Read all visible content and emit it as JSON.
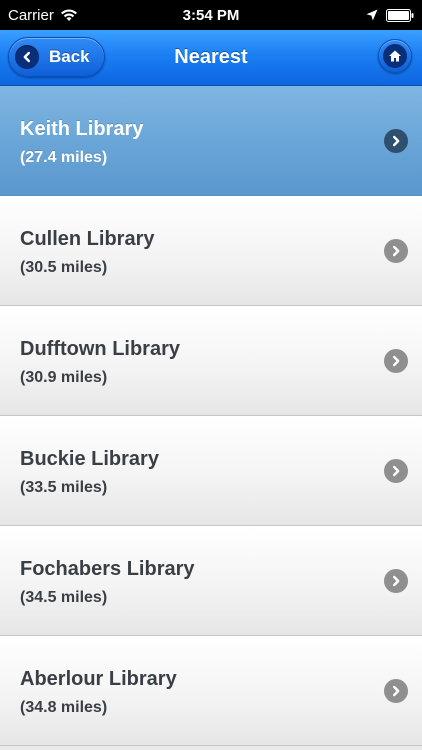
{
  "status_bar": {
    "carrier": "Carrier",
    "time": "3:54 PM",
    "icons": [
      "wifi-icon",
      "location-icon",
      "battery-icon"
    ]
  },
  "nav": {
    "back_label": "Back",
    "title": "Nearest",
    "home_icon": "home-icon"
  },
  "libraries": [
    {
      "name": "Keith Library",
      "distance": "(27.4 miles)",
      "selected": true
    },
    {
      "name": "Cullen Library",
      "distance": "(30.5 miles)",
      "selected": false
    },
    {
      "name": "Dufftown Library",
      "distance": "(30.9 miles)",
      "selected": false
    },
    {
      "name": "Buckie Library",
      "distance": "(33.5 miles)",
      "selected": false
    },
    {
      "name": "Fochabers Library",
      "distance": "(34.5 miles)",
      "selected": false
    },
    {
      "name": "Aberlour Library",
      "distance": "(34.8 miles)",
      "selected": false
    }
  ],
  "colors": {
    "nav_blue": "#1b7ff3",
    "selected_row": "#6aa6d8",
    "text": "#3a3f45"
  }
}
